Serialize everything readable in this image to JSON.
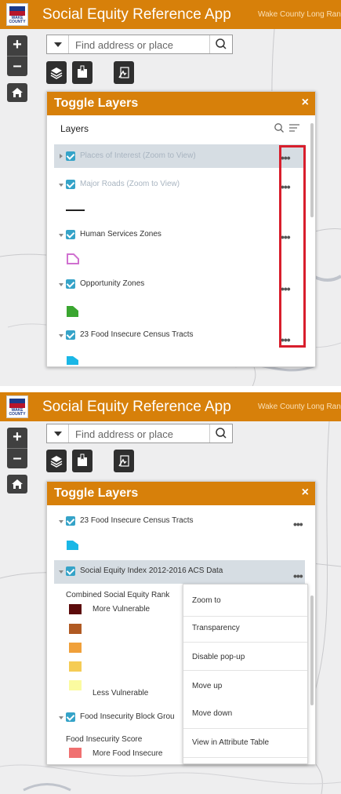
{
  "header": {
    "app_title": "Social Equity Reference App",
    "subtitle": "Wake County Long Range Plan",
    "logo_text": "WAKE COUNTY",
    "color": "#d7800a"
  },
  "search": {
    "placeholder": "Find address or place"
  },
  "zoom": {
    "in_label": "+",
    "out_label": "–"
  },
  "panel": {
    "title": "Toggle Layers",
    "close_label": "×",
    "layers_heading": "Layers"
  },
  "screen1": {
    "layers": [
      {
        "label": "Places of Interest (Zoom to View)",
        "dimmed": true,
        "expanded": false
      },
      {
        "label": "Major Roads (Zoom to View)",
        "dimmed": true,
        "expanded": true
      },
      {
        "label": "Human Services Zones",
        "dimmed": false,
        "expanded": true
      },
      {
        "label": "Opportunity Zones",
        "dimmed": false,
        "expanded": true
      },
      {
        "label": "23 Food Insecure Census Tracts",
        "dimmed": false,
        "expanded": true
      }
    ],
    "more_label": "•••"
  },
  "screen2": {
    "layers": [
      {
        "label": "23 Food Insecure Census Tracts"
      },
      {
        "label": "Social Equity Index 2012-2016 ACS Data"
      },
      {
        "label": "Food Insecurity Block Grou"
      }
    ],
    "legend": {
      "title": "Combined Social Equity Rank",
      "items": [
        {
          "label": "More Vulnerable",
          "color": "#5c0b0b"
        },
        {
          "label": "",
          "color": "#b05a23"
        },
        {
          "label": "",
          "color": "#f0a03a"
        },
        {
          "label": "",
          "color": "#f5cc55"
        },
        {
          "label": "Less Vulnerable",
          "color": "#fbfba0"
        }
      ]
    },
    "food_legend": {
      "title": "Food Insecurity Score",
      "items": [
        {
          "label": "More Food Insecure",
          "color": "#f07070"
        }
      ]
    },
    "menu_items": [
      "Zoom to",
      "Transparency",
      "Disable pop-up",
      "Move up",
      "Move down",
      "View in Attribute Table"
    ],
    "more_label": "•••"
  },
  "colors": {
    "accent": "#d7800a",
    "checkbox": "#35a3c8",
    "tract_fill": "#1ab7e6",
    "opportunity_fill": "#3aa630",
    "human_services_outline": "#d070d0",
    "highlight": "#d81e2c"
  }
}
